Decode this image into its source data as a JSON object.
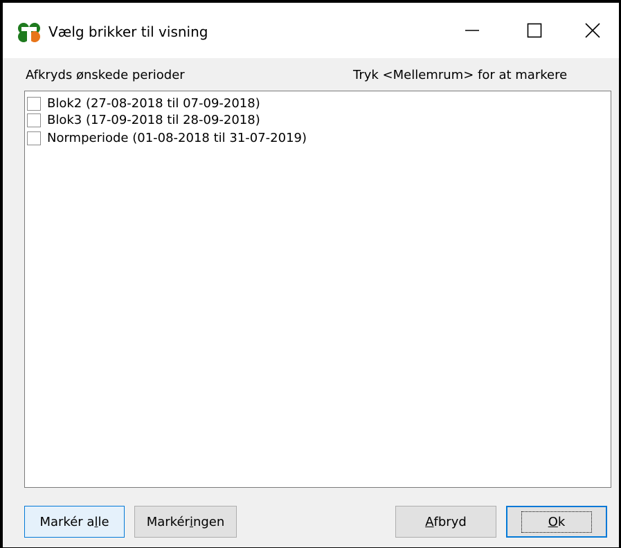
{
  "window": {
    "title": "Vælg brikker til visning",
    "icon": "clover-app-icon"
  },
  "header": {
    "left_label": "Afkryds ønskede perioder",
    "right_label": "Tryk <Mellemrum> for at markere"
  },
  "list": {
    "items": [
      {
        "label": "Blok2 (27-08-2018 til 07-09-2018)",
        "checked": false
      },
      {
        "label": "Blok3 (17-09-2018 til 28-09-2018)",
        "checked": false
      },
      {
        "label": "Normperiode (01-08-2018 til 31-07-2019)",
        "checked": false
      }
    ]
  },
  "buttons": {
    "select_all": {
      "pre": "Markér a",
      "accel": "l",
      "post": "le"
    },
    "select_none": {
      "pre": "Markér ",
      "accel": "i",
      "post": "ngen"
    },
    "cancel": {
      "pre": "",
      "accel": "A",
      "post": "fbryd"
    },
    "ok": {
      "pre": "",
      "accel": "O",
      "post": "k"
    }
  },
  "colors": {
    "accent": "#0078d7",
    "icon_green": "#1e7a1e",
    "icon_orange": "#e8751a"
  }
}
